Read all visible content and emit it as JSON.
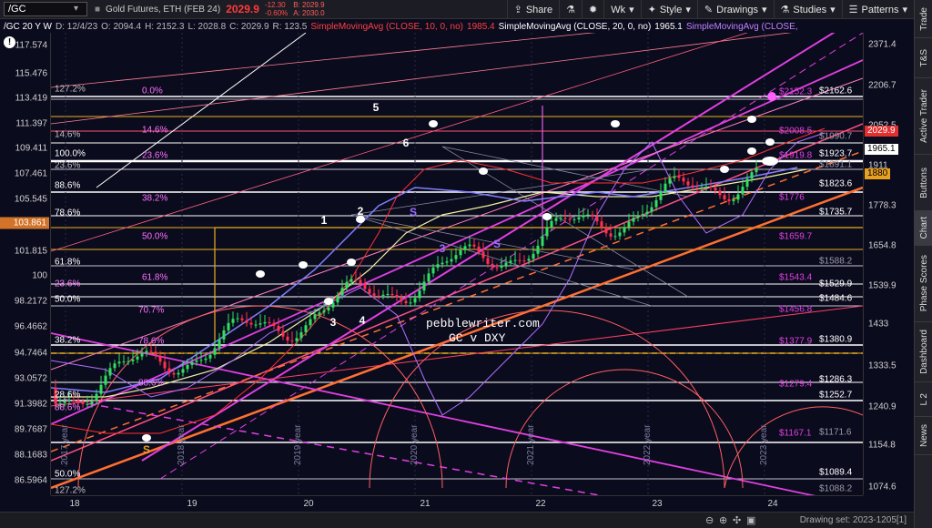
{
  "toolbar": {
    "symbol": "/GC",
    "description": "Gold Futures, ETH (FEB 24)",
    "price": "2029.9",
    "change": "-12.30",
    "change_pct": "-0.60%",
    "bid": "B: 2029.9",
    "ask": "A: 2030.0",
    "share": "Share",
    "period": "Wk",
    "style": "Style",
    "drawings": "Drawings",
    "studies": "Studies",
    "patterns": "Patterns"
  },
  "study_row": {
    "symbol": "/GC 20 Y W",
    "date": "D: 12/4/23",
    "open": "O: 2094.4",
    "high": "H: 2152.3",
    "low": "L: 2028.8",
    "close": "C: 2029.9",
    "range": "R: 123.5",
    "sma10": "SimpleMovingAvg (CLOSE, 10, 0, no)",
    "sma10_val": "1985.4",
    "sma20": "SimpleMovingAvg (CLOSE, 20, 0, no)",
    "sma20_val": "1965.1",
    "sma20b": "SimpleMovingAvg (CLOSE,"
  },
  "left_axis": {
    "ticks": [
      "117.574",
      "115.476",
      "113.419",
      "111.397",
      "109.411",
      "107.461",
      "105.545",
      "103.861",
      "101.815",
      "100",
      "98.2172",
      "96.4662",
      "94.7464",
      "93.0572",
      "91.3982",
      "89.7687",
      "88.1683",
      "86.5964"
    ],
    "current": "103.861",
    "info_icon": "!"
  },
  "right_axis": {
    "ticks": [
      "2371.4",
      "2206.7",
      "2052.5",
      "1911",
      "1778.3",
      "1654.8",
      "1539.9",
      "1433",
      "1333.5",
      "1240.9",
      "1154.8",
      "1074.6"
    ],
    "current_price": "2029.9",
    "sma_box": "1965.1",
    "level_box": "1880"
  },
  "time_axis": {
    "ticks": [
      "18",
      "19",
      "20",
      "21",
      "22",
      "23",
      "24"
    ]
  },
  "right_tabs": [
    "Trade",
    "T&S",
    "Active Trader",
    "Buttons",
    "Chart",
    "Phase Scores",
    "Dashboard",
    "L 2",
    "News"
  ],
  "active_tab": "Chart",
  "levels": [
    {
      "label": "$2152.3",
      "color": "#e040e0"
    },
    {
      "label": "$2162.6",
      "color": "#ffffff"
    },
    {
      "label": "$2008.5",
      "color": "#e040e0"
    },
    {
      "label": "$1990.7",
      "color": "#9a9aa8"
    },
    {
      "label": "$1923.7",
      "color": "#ffffff"
    },
    {
      "label": "$1919.8",
      "color": "#e040e0"
    },
    {
      "label": "$1891.1",
      "color": "#9a9aa8"
    },
    {
      "label": "$1823.6",
      "color": "#ffffff"
    },
    {
      "label": "$1776",
      "color": "#e040e0"
    },
    {
      "label": "$1735.7",
      "color": "#ffffff"
    },
    {
      "label": "$1659.7",
      "color": "#e040e0"
    },
    {
      "label": "$1588.2",
      "color": "#9a9aa8"
    },
    {
      "label": "$1543.4",
      "color": "#e040e0"
    },
    {
      "label": "$1529.9",
      "color": "#ffffff"
    },
    {
      "label": "$1484.6",
      "color": "#ffffff"
    },
    {
      "label": "$1456.8",
      "color": "#e040e0"
    },
    {
      "label": "$1377.9",
      "color": "#e040e0"
    },
    {
      "label": "$1380.9",
      "color": "#ffffff"
    },
    {
      "label": "$1286.3",
      "color": "#ffffff"
    },
    {
      "label": "$1279.4",
      "color": "#e040e0"
    },
    {
      "label": "$1252.7",
      "color": "#ffffff"
    },
    {
      "label": "$1167.1",
      "color": "#e040e0"
    },
    {
      "label": "$1171.6",
      "color": "#9a9aa8"
    },
    {
      "label": "$1089.4",
      "color": "#ffffff"
    },
    {
      "label": "$1088.2",
      "color": "#9a9aa8"
    }
  ],
  "fib_labels": {
    "pct_left": [
      "127.2%",
      "14.6%",
      "100.0%",
      "23.6%",
      "88.6%",
      "78.6%",
      "61.8%",
      "23.6%",
      "50.0%",
      "38.2%",
      "28.6%",
      "88.6%",
      "50.0%",
      "127.2%"
    ],
    "pct_mid": [
      "0.0%",
      "14.6%",
      "23.6%",
      "38.2%",
      "50.0%",
      "61.8%",
      "70.7%",
      "78.6%",
      "88.6%"
    ]
  },
  "wave_labels": [
    "5",
    "6",
    "1",
    "2",
    "3",
    "4",
    "S",
    "S",
    "S",
    "3"
  ],
  "year_labels": [
    "2018 year",
    "2019 year",
    "2020 year",
    "2021 year",
    "2022 year",
    "2023 year",
    "2017 year"
  ],
  "watermark": {
    "line1": "pebblewriter.com",
    "line2": "GC v DXY"
  },
  "status": {
    "drawing_set": "Drawing set: 2023-1205[1]"
  }
}
